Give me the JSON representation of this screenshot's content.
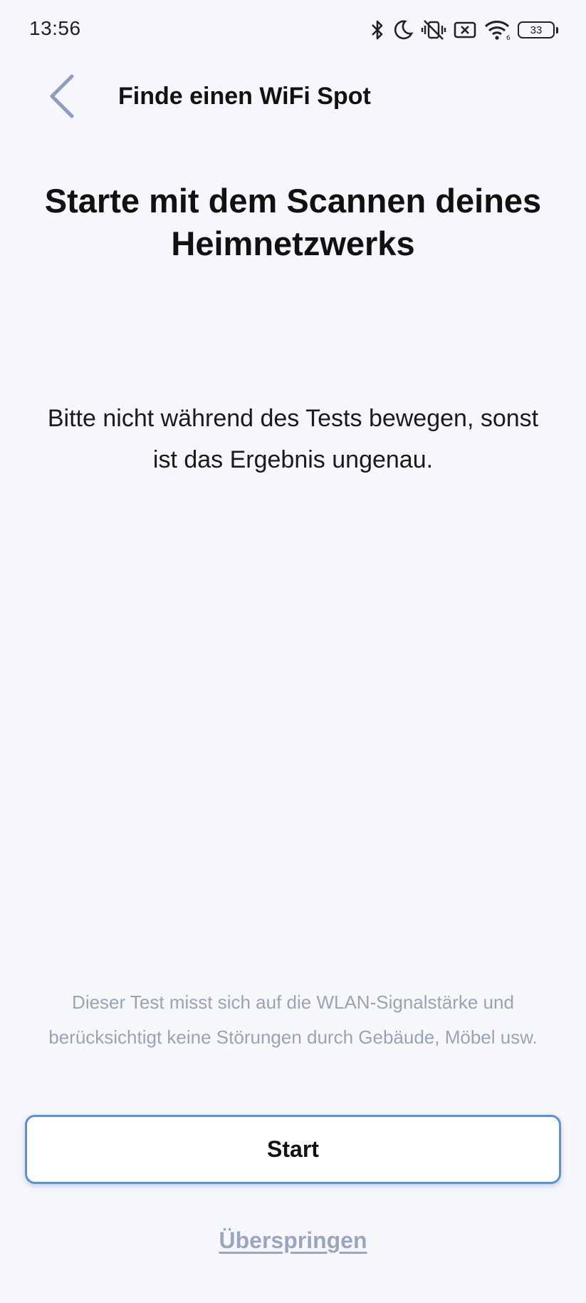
{
  "status_bar": {
    "time": "13:56",
    "battery_level": "33",
    "icons": [
      "bluetooth-icon",
      "do-not-disturb-moon-icon",
      "vibrate-off-icon",
      "no-sim-icon",
      "wifi-icon",
      "battery-icon"
    ]
  },
  "header": {
    "back_icon": "chevron-left-icon",
    "title": "Finde einen WiFi Spot"
  },
  "main": {
    "headline": "Starte mit dem Scannen deines Heimnetzwerks",
    "instruction": "Bitte nicht während des Tests bewegen, sonst ist das Ergebnis ungenau.",
    "disclaimer": "Dieser Test misst sich auf die WLAN-Signalstärke und berücksichtigt keine Störungen durch Gebäude, Möbel usw."
  },
  "actions": {
    "start_label": "Start",
    "skip_label": "Überspringen"
  },
  "colors": {
    "background": "#f6f7fb",
    "accent_border": "#5b8fd8",
    "muted_text": "#9aa3b5",
    "back_icon": "#8e9cc0"
  }
}
